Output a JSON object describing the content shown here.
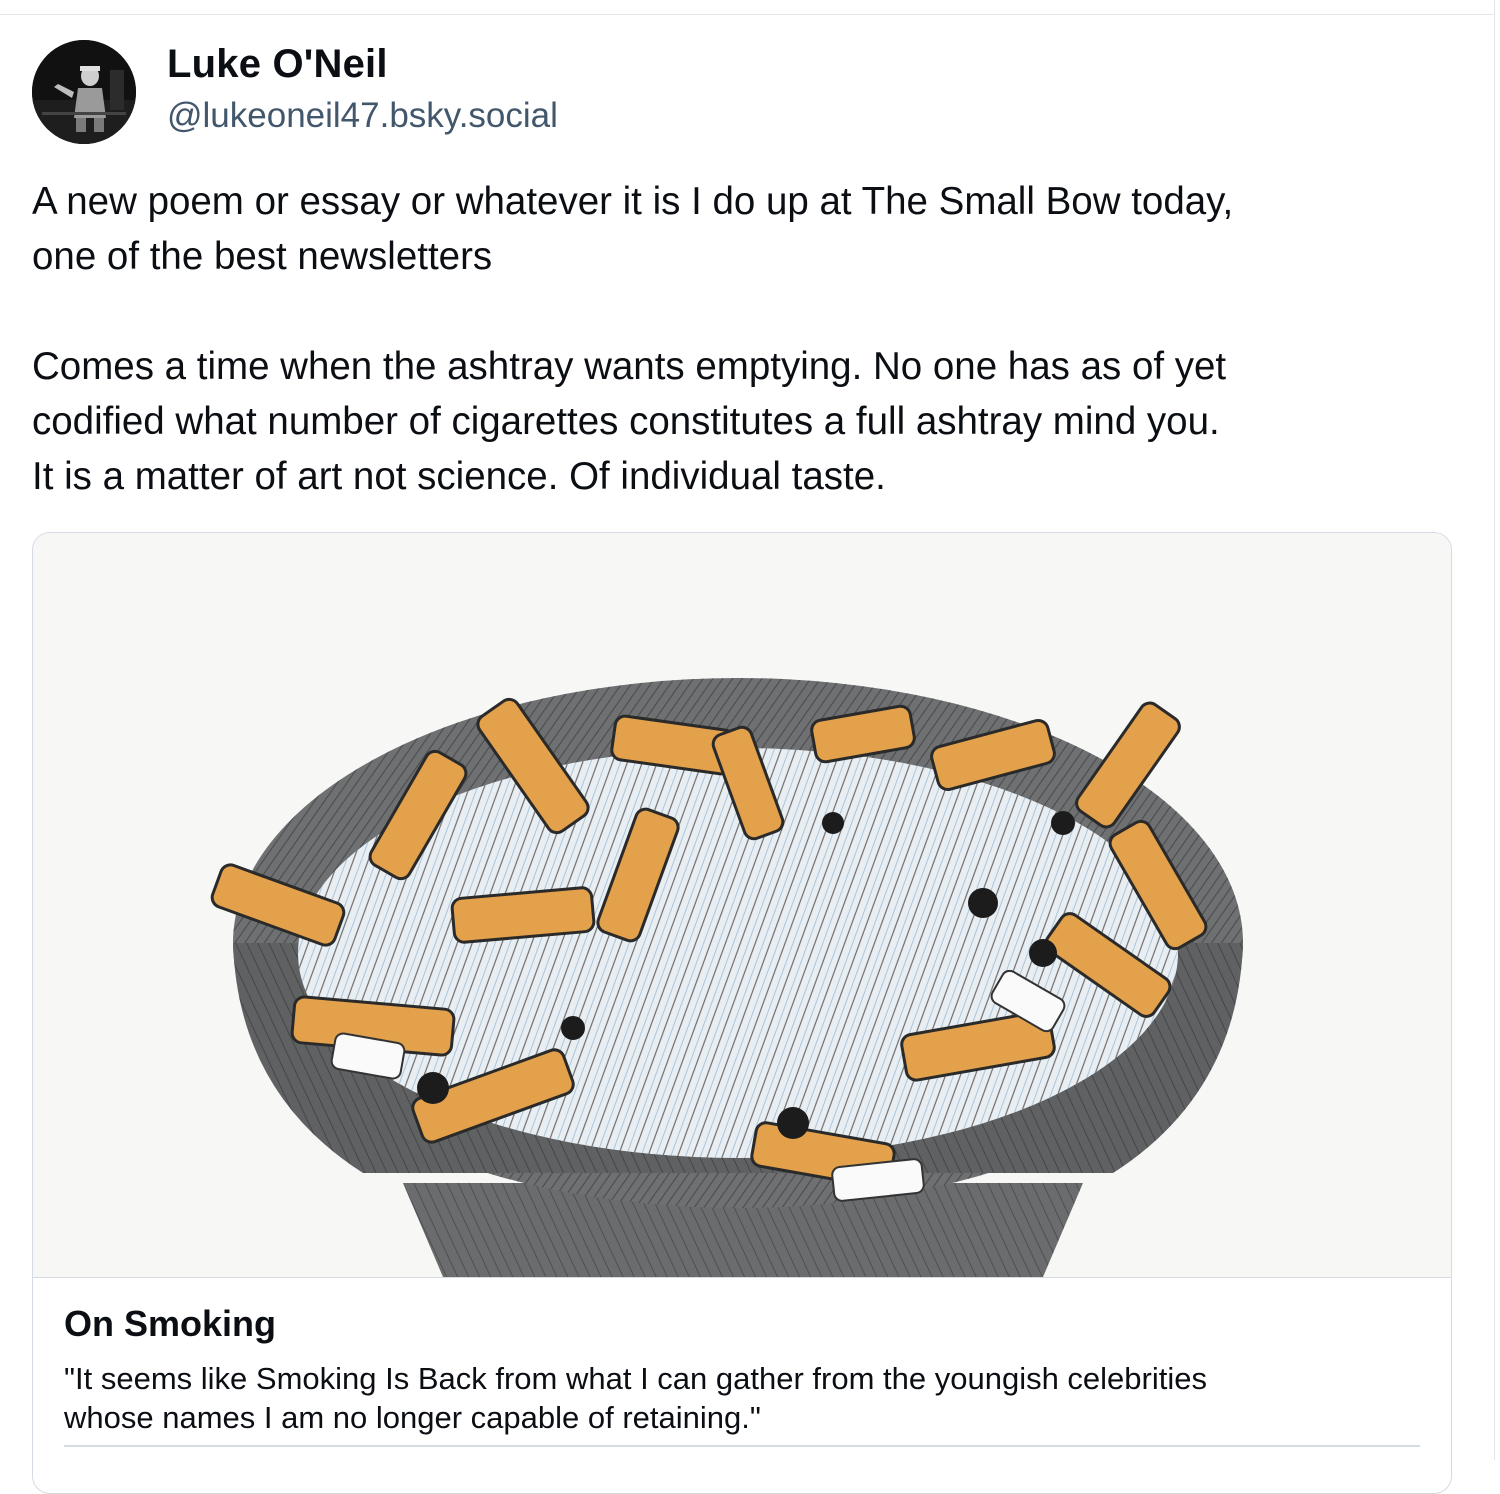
{
  "author": {
    "display_name": "Luke O'Neil",
    "handle": "@lukeoneil47.bsky.social",
    "avatar_icon": "avatar-photo"
  },
  "post": {
    "paragraph_1": "A new poem or essay or whatever it is I do up at The Small Bow today,\none of the best newsletters",
    "paragraph_2": "Comes a time when the ashtray wants emptying. No one has as of yet\ncodified what number of cigarettes constitutes a full ashtray mind you.\nIt is a matter of art not science. Of individual taste."
  },
  "link_card": {
    "image_icon": "ashtray-illustration",
    "title": "On Smoking",
    "description": "\"It seems like Smoking Is Back from what I can gather from the youngish celebrities\nwhose names I am no longer capable of retaining.\""
  },
  "colors": {
    "text": "#0b0f14",
    "handle": "#42576c",
    "border": "#d4dbe2",
    "cigarette_filter": "#e0a04a",
    "ashtray": "#5b5d5f",
    "ash_blue": "#8fb4d0"
  }
}
